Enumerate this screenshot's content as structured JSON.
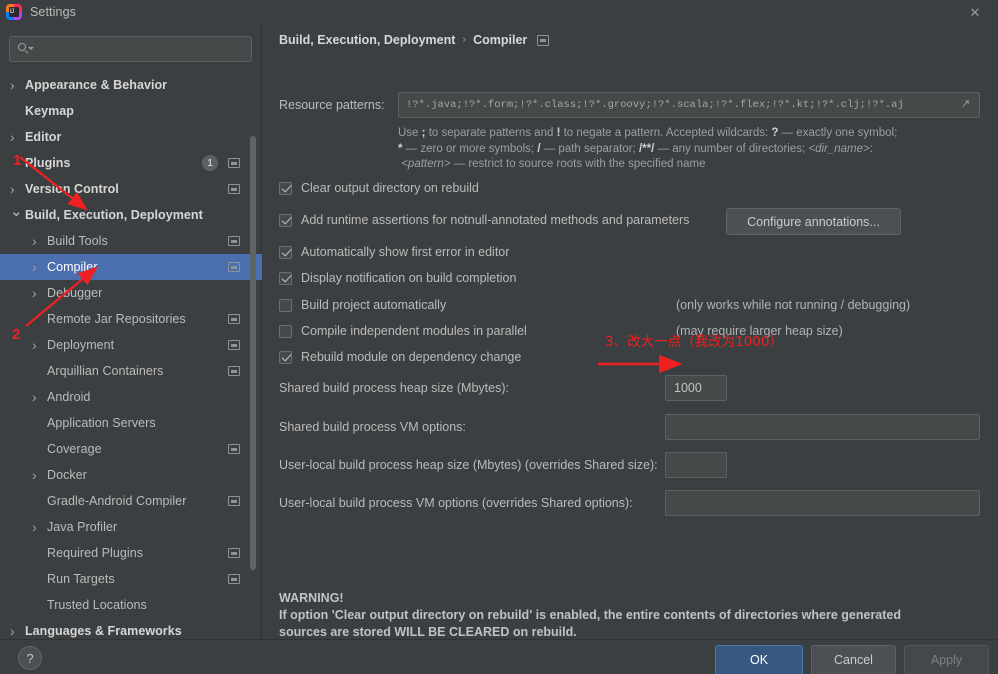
{
  "window": {
    "title": "Settings",
    "logo_icon": "intellij-idea-logo",
    "close_icon": "close-icon"
  },
  "sidebar": {
    "search": {
      "placeholder": "",
      "value": "",
      "icon": "search-icon",
      "dropdown_icon": "chevron-down-icon"
    },
    "items": [
      {
        "label": "Appearance & Behavior",
        "arrow": "right",
        "level": 0,
        "bold": true,
        "project_icon": false,
        "badge": null
      },
      {
        "label": "Keymap",
        "arrow": "none",
        "level": 0,
        "bold": true,
        "project_icon": false,
        "badge": null
      },
      {
        "label": "Editor",
        "arrow": "right",
        "level": 0,
        "bold": true,
        "project_icon": false,
        "badge": null
      },
      {
        "label": "Plugins",
        "arrow": "none",
        "level": 0,
        "bold": true,
        "project_icon": true,
        "badge": "1"
      },
      {
        "label": "Version Control",
        "arrow": "right",
        "level": 0,
        "bold": true,
        "project_icon": true,
        "badge": null
      },
      {
        "label": "Build, Execution, Deployment",
        "arrow": "down",
        "level": 0,
        "bold": true,
        "project_icon": false,
        "badge": null
      },
      {
        "label": "Build Tools",
        "arrow": "right",
        "level": 1,
        "bold": false,
        "project_icon": true,
        "badge": null
      },
      {
        "label": "Compiler",
        "arrow": "right",
        "level": 1,
        "bold": false,
        "project_icon": true,
        "badge": null,
        "selected": true
      },
      {
        "label": "Debugger",
        "arrow": "right",
        "level": 1,
        "bold": false,
        "project_icon": false,
        "badge": null
      },
      {
        "label": "Remote Jar Repositories",
        "arrow": "none",
        "level": 1,
        "bold": false,
        "project_icon": true,
        "badge": null
      },
      {
        "label": "Deployment",
        "arrow": "right",
        "level": 1,
        "bold": false,
        "project_icon": true,
        "badge": null
      },
      {
        "label": "Arquillian Containers",
        "arrow": "none",
        "level": 1,
        "bold": false,
        "project_icon": true,
        "badge": null
      },
      {
        "label": "Android",
        "arrow": "right",
        "level": 1,
        "bold": false,
        "project_icon": false,
        "badge": null
      },
      {
        "label": "Application Servers",
        "arrow": "none",
        "level": 1,
        "bold": false,
        "project_icon": false,
        "badge": null
      },
      {
        "label": "Coverage",
        "arrow": "none",
        "level": 1,
        "bold": false,
        "project_icon": true,
        "badge": null
      },
      {
        "label": "Docker",
        "arrow": "right",
        "level": 1,
        "bold": false,
        "project_icon": false,
        "badge": null
      },
      {
        "label": "Gradle-Android Compiler",
        "arrow": "none",
        "level": 1,
        "bold": false,
        "project_icon": true,
        "badge": null
      },
      {
        "label": "Java Profiler",
        "arrow": "right",
        "level": 1,
        "bold": false,
        "project_icon": false,
        "badge": null
      },
      {
        "label": "Required Plugins",
        "arrow": "none",
        "level": 1,
        "bold": false,
        "project_icon": true,
        "badge": null
      },
      {
        "label": "Run Targets",
        "arrow": "none",
        "level": 1,
        "bold": false,
        "project_icon": true,
        "badge": null
      },
      {
        "label": "Trusted Locations",
        "arrow": "none",
        "level": 1,
        "bold": false,
        "project_icon": false,
        "badge": null
      },
      {
        "label": "Languages & Frameworks",
        "arrow": "right",
        "level": 0,
        "bold": true,
        "project_icon": false,
        "badge": null
      }
    ]
  },
  "breadcrumb": {
    "root": "Build, Execution, Deployment",
    "separator": "›",
    "current": "Compiler",
    "project_icon": "project-scope-icon"
  },
  "main": {
    "resource_patterns": {
      "label": "Resource patterns:",
      "value": "!?*.java;!?*.form;!?*.class;!?*.groovy;!?*.scala;!?*.flex;!?*.kt;!?*.clj;!?*.aj",
      "expand_icon": "expand-icon"
    },
    "help_line1_a": "Use ",
    "help_semicolon": ";",
    "help_line1_b": " to separate patterns and ",
    "help_bang": "!",
    "help_line1_c": " to negate a pattern. Accepted wildcards: ",
    "help_question": "?",
    "help_line1_d": " — exactly one symbol;",
    "help_star": "*",
    "help_line2_a": " — zero or more symbols; ",
    "help_slash": "/",
    "help_line2_b": " — path separator; ",
    "help_globstar": "/**/",
    "help_line2_c": " — any number of directories; ",
    "help_dirname": "<dir_name>",
    "help_colon": ":",
    "help_pattern": "<pattern>",
    "help_line3": " — restrict to source roots with the specified name",
    "checkboxes": [
      {
        "label": "Clear output directory on rebuild",
        "checked": true,
        "note": ""
      },
      {
        "label": "Add runtime assertions for notnull-annotated methods and parameters",
        "checked": true,
        "note": ""
      },
      {
        "label": "Automatically show first error in editor",
        "checked": true,
        "note": ""
      },
      {
        "label": "Display notification on build completion",
        "checked": true,
        "note": ""
      },
      {
        "label": "Build project automatically",
        "checked": false,
        "note": "(only works while not running / debugging)"
      },
      {
        "label": "Compile independent modules in parallel",
        "checked": false,
        "note": "(may require larger heap size)"
      },
      {
        "label": "Rebuild module on dependency change",
        "checked": true,
        "note": ""
      }
    ],
    "configure_annotations_button": "Configure annotations...",
    "fields": [
      {
        "label": "Shared build process heap size (Mbytes):",
        "value": "1000",
        "placeholder": ""
      },
      {
        "label": "Shared build process VM options:",
        "value": "",
        "placeholder": ""
      },
      {
        "label": "User-local build process heap size (Mbytes) (overrides Shared size):",
        "value": "",
        "placeholder": ""
      },
      {
        "label": "User-local build process VM options (overrides Shared options):",
        "value": "",
        "placeholder": ""
      }
    ],
    "warning": {
      "title": "WARNING!",
      "line1": "If option 'Clear output directory on rebuild' is enabled, the entire contents of directories where generated",
      "line2": "sources are stored WILL BE CLEARED on rebuild."
    }
  },
  "annotations": {
    "color": "#f02020",
    "marker1": "1",
    "marker2": "2",
    "note3": "3、改大一点（我改为1000）"
  },
  "footer": {
    "help_label": "?",
    "ok_label": "OK",
    "cancel_label": "Cancel",
    "apply_label": "Apply"
  }
}
